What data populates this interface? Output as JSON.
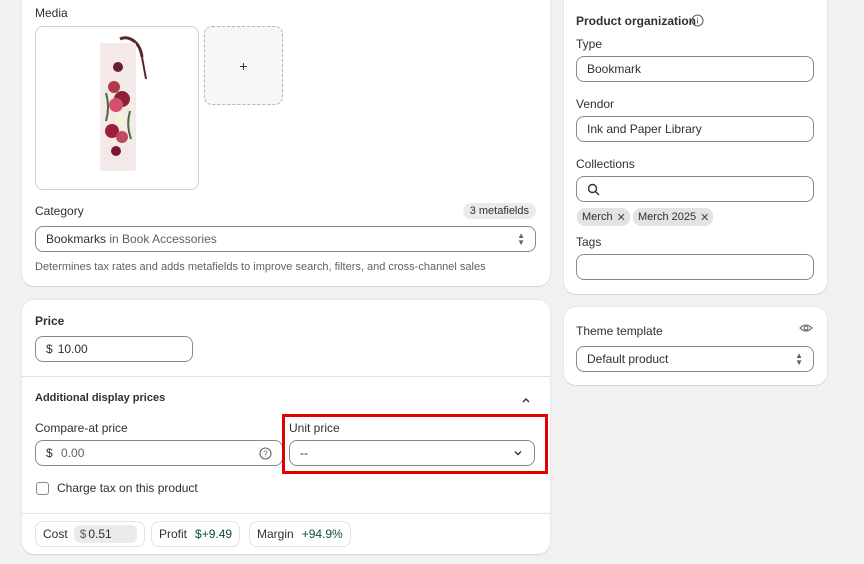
{
  "media": {
    "heading": "Media",
    "add_label": "+"
  },
  "category": {
    "label": "Category",
    "metafields_badge": "3 metafields",
    "value_main": "Bookmarks",
    "value_suffix": "in Book Accessories",
    "help": "Determines tax rates and adds metafields to improve search, filters, and cross-channel sales"
  },
  "price": {
    "heading": "Price",
    "currency": "$",
    "value": "10.00",
    "additional_heading": "Additional display prices",
    "compare_label": "Compare-at price",
    "compare_currency": "$",
    "compare_placeholder": "0.00",
    "unit_label": "Unit price",
    "unit_value": "--",
    "tax_label": "Charge tax on this product",
    "tax_checked": false,
    "cost_label": "Cost",
    "cost_currency": "$",
    "cost_value": "0.51",
    "profit_label": "Profit",
    "profit_value": "$+9.49",
    "margin_label": "Margin",
    "margin_value": "+94.9%"
  },
  "organization": {
    "heading": "Product organization",
    "type_label": "Type",
    "type_value": "Bookmark",
    "vendor_label": "Vendor",
    "vendor_value": "Ink and Paper Library",
    "collections_label": "Collections",
    "collections": [
      "Merch",
      "Merch 2025"
    ],
    "tags_label": "Tags"
  },
  "theme": {
    "heading": "Theme template",
    "value": "Default product"
  },
  "colors": {
    "highlight": "#e00000",
    "profit_green": "#0c5132"
  }
}
